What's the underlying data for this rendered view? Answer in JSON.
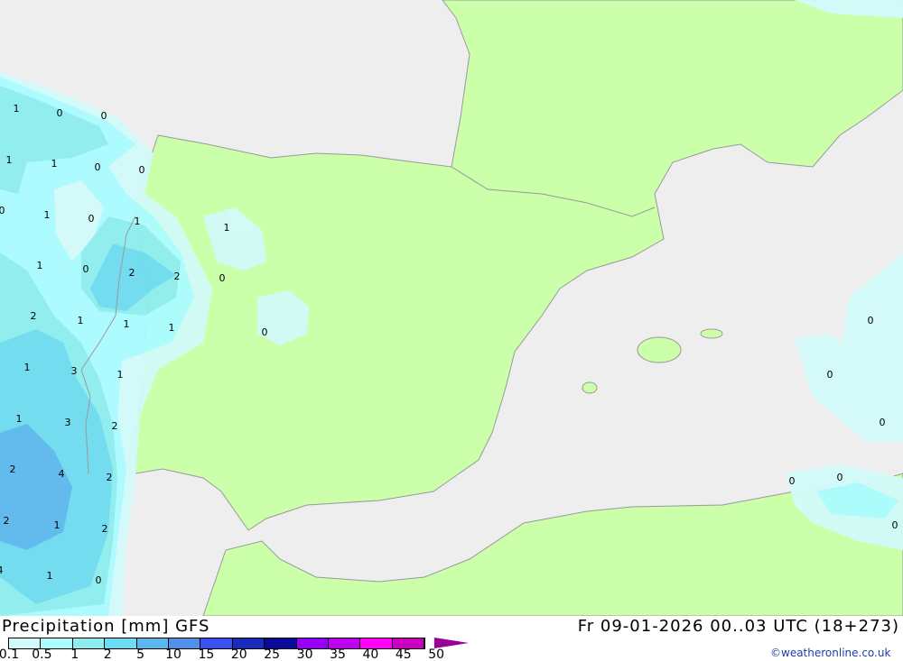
{
  "title": "Precipitation [mm] GFS",
  "valid_time": "Fr 09-01-2026 00..03 UTC (18+273)",
  "credit": "©weatheronline.co.uk",
  "colors": {
    "sea": "#eeeeee",
    "land": "#ccffaa",
    "border": "#999999"
  },
  "legend": {
    "ticks": [
      "0.1",
      "0.5",
      "1",
      "2",
      "5",
      "10",
      "15",
      "20",
      "25",
      "30",
      "35",
      "40",
      "45",
      "50"
    ],
    "colors": [
      "#d2fafa",
      "#aafcff",
      "#8eeeee",
      "#6edcf0",
      "#5cb8ec",
      "#5090e8",
      "#3a50f0",
      "#1a2cbc",
      "#0a0a9a",
      "#9600f8",
      "#c000f0",
      "#ff00f8",
      "#cc00c0"
    ],
    "arrow_color": "#990099"
  },
  "map_labels": [
    "1",
    "0",
    "0",
    "1",
    "1",
    "0",
    "0",
    "0",
    "1",
    "0",
    "1",
    "1",
    "0",
    "2",
    "2",
    "0",
    "2",
    "1",
    "1",
    "1",
    "0",
    "1",
    "3",
    "1",
    "1",
    "3",
    "1",
    "2",
    "2",
    "4",
    "2",
    "1",
    "2",
    "2",
    "4",
    "1",
    "0",
    "0",
    "0",
    "0",
    "0",
    "0",
    "0"
  ]
}
